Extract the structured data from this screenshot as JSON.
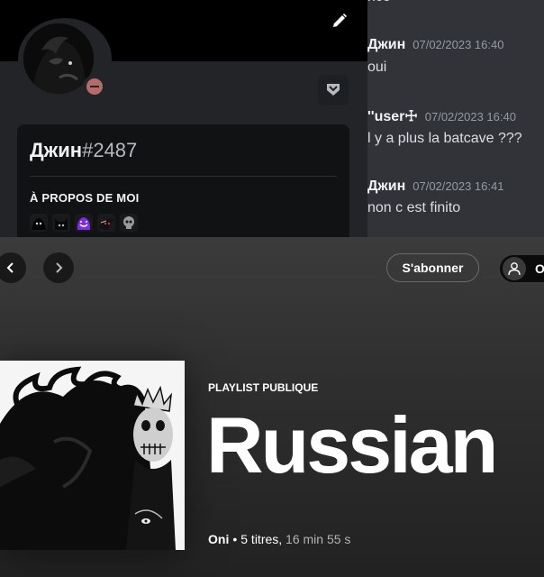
{
  "profile": {
    "username": "Джин",
    "tag": "#2487",
    "about_title": "À PROPOS DE MOI",
    "emojis": [
      "black-creature-emoji",
      "dark-cat-emoji",
      "purple-smile-emoji",
      "red-eyes-emoji",
      "skull-emoji"
    ]
  },
  "chat": {
    "partial_top": "nco",
    "messages": [
      {
        "author": "Джин",
        "time": "07/02/2023 16:40",
        "text": "oui"
      },
      {
        "author": "''user☩",
        "time": "07/02/2023 16:40",
        "text": "l y a plus la batcave ???"
      },
      {
        "author": "Джин",
        "time": "07/02/2023 16:41",
        "text": "non c est finito"
      }
    ]
  },
  "spotify": {
    "subscribe_label": "S'abonner",
    "user_initial": "O",
    "playlist_type": "PLAYLIST PUBLIQUE",
    "playlist_title": "Russian",
    "owner": "Oni",
    "separator": "•",
    "track_count": "5 titres,",
    "duration": "16 min 55 s"
  },
  "colors": {
    "discord_bg": "#313338",
    "profile_bg": "#232428",
    "card_bg": "#111214",
    "status_dnd": "#b66a6a",
    "spotify_bg": "#2e2e2e"
  }
}
